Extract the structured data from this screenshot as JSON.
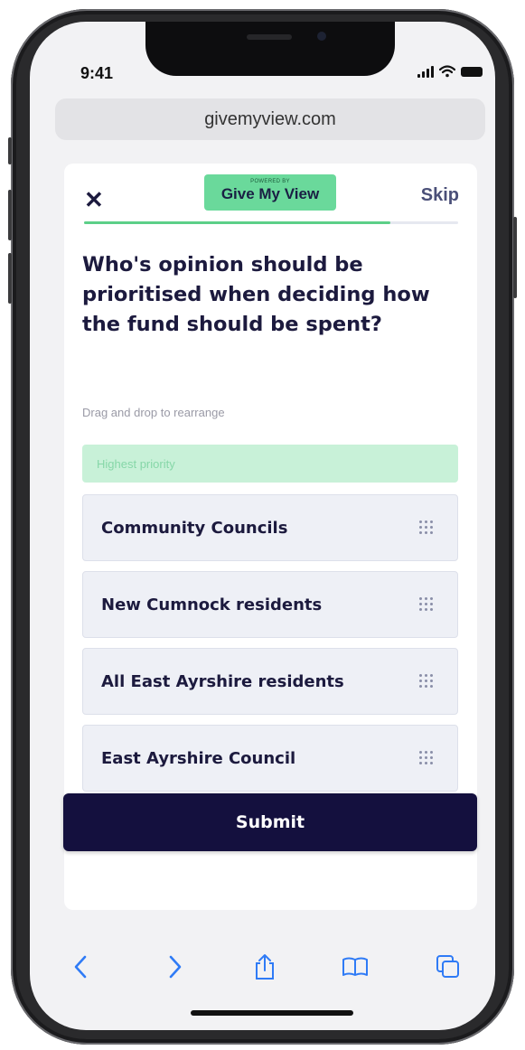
{
  "status_bar": {
    "time": "9:41"
  },
  "browser": {
    "url": "givemyview.com"
  },
  "header": {
    "close_label": "✕",
    "brand_powered": "POWERED BY",
    "brand_name": "Give My View",
    "skip_label": "Skip",
    "progress_fraction": 0.82
  },
  "question": {
    "text": "Who's opinion should be prioritised when deciding how the fund should be spent?",
    "instruction": "Drag and drop to rearrange",
    "highest_label": "Highest priority"
  },
  "rank_items": [
    {
      "label": "Community Councils"
    },
    {
      "label": "New Cumnock residents"
    },
    {
      "label": "All East Ayrshire residents"
    },
    {
      "label": "East Ayrshire Council"
    }
  ],
  "submit_label": "Submit",
  "toolbar_icons": [
    "back-icon",
    "forward-icon",
    "share-icon",
    "bookmarks-icon",
    "tabs-icon"
  ],
  "colors": {
    "primary": "#14103e",
    "brand_green": "#6ad99b",
    "accent_blue": "#2f7bf6",
    "highest_bg": "#c8f1d8",
    "lowest_bg": "#f8c9c3"
  }
}
